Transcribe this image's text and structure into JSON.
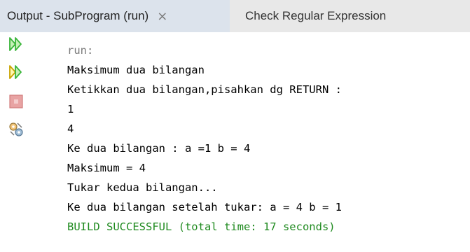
{
  "tabs": [
    {
      "label": "Output - SubProgram (run)",
      "close": "×",
      "active": true
    },
    {
      "label": "Check Regular Expression",
      "active": false
    }
  ],
  "toolbar": [
    {
      "name": "rerun-icon"
    },
    {
      "name": "rerun-with-options-icon"
    },
    {
      "name": "stop-icon"
    },
    {
      "name": "settings-icon"
    }
  ],
  "console": {
    "lines": [
      {
        "text": "run:",
        "kind": "meta"
      },
      {
        "text": "Maksimum dua bilangan",
        "kind": "normal"
      },
      {
        "text": "Ketikkan dua bilangan,pisahkan dg RETURN :",
        "kind": "normal"
      },
      {
        "text": "1",
        "kind": "normal"
      },
      {
        "text": "4",
        "kind": "normal"
      },
      {
        "text": "Ke dua bilangan : a =1 b = 4",
        "kind": "normal"
      },
      {
        "text": "Maksimum = 4",
        "kind": "normal"
      },
      {
        "text": "Tukar kedua bilangan...",
        "kind": "normal"
      },
      {
        "text": "Ke dua bilangan setelah tukar: a = 4 b = 1",
        "kind": "normal"
      },
      {
        "text": "BUILD SUCCESSFUL (total time: 17 seconds)",
        "kind": "success"
      }
    ]
  },
  "colors": {
    "tab_active_bg": "#dce3ec",
    "tab_bar_bg": "#e8e8e8",
    "meta_text": "#7a7a7a",
    "success_text": "#1f8a1f",
    "rerun_green": "#3ab53a"
  }
}
